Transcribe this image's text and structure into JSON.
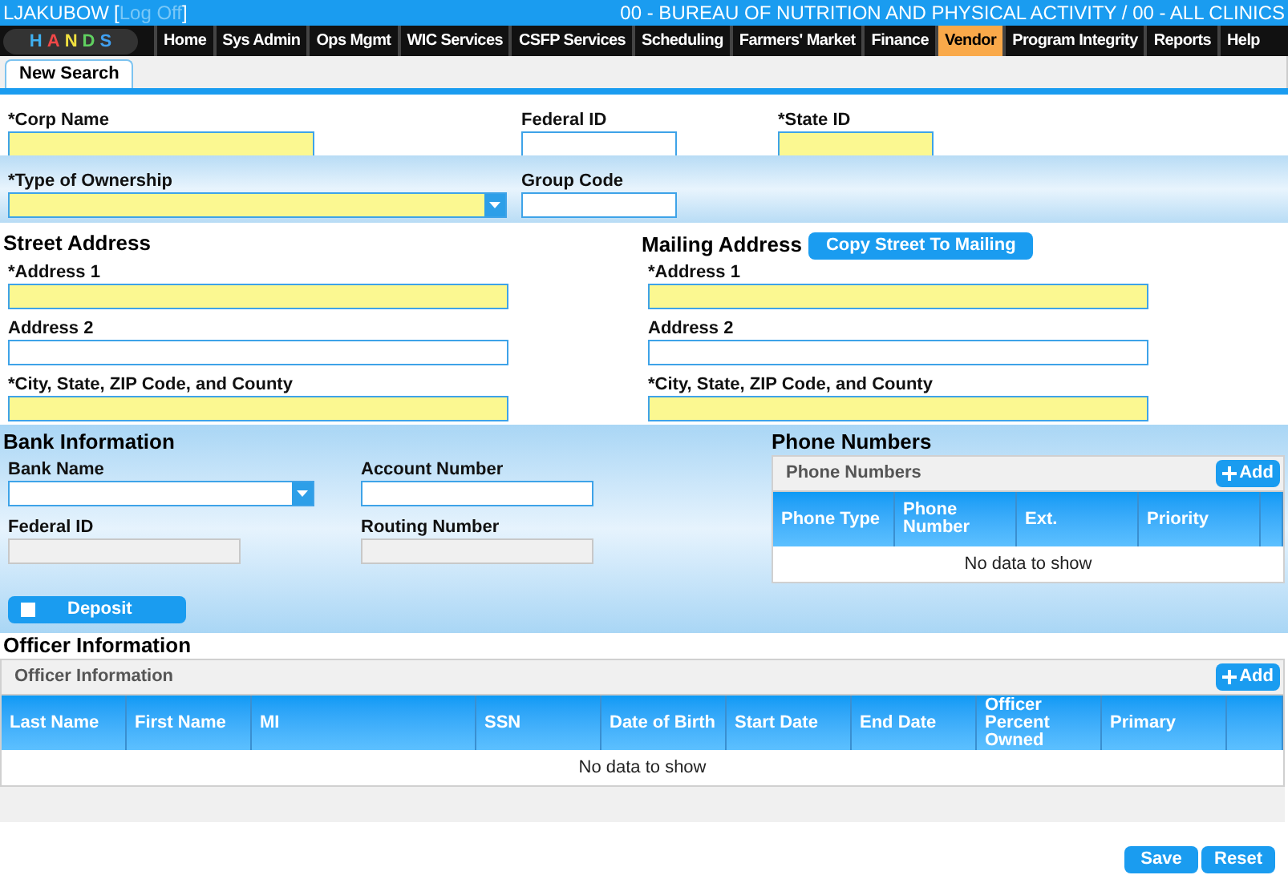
{
  "header": {
    "user": "LJAKUBOW",
    "open_bracket": "[",
    "logoff": "Log Off",
    "close_bracket": "]",
    "agency": "00 - BUREAU OF NUTRITION AND PHYSICAL ACTIVITY / 00 - ALL CLINICS"
  },
  "logo": {
    "letters": [
      {
        "text": "H",
        "color": "#3fb0f0"
      },
      {
        "text": "A",
        "color": "#f04848"
      },
      {
        "text": "N",
        "color": "#f0e040"
      },
      {
        "text": "D",
        "color": "#60d060"
      },
      {
        "text": "S",
        "color": "#40a0f0"
      }
    ]
  },
  "nav": [
    {
      "label": "Home",
      "selected": false
    },
    {
      "label": "Sys Admin",
      "selected": false
    },
    {
      "label": "Ops Mgmt",
      "selected": false
    },
    {
      "label": "WIC Services",
      "selected": false
    },
    {
      "label": "CSFP Services",
      "selected": false
    },
    {
      "label": "Scheduling",
      "selected": false
    },
    {
      "label": "Farmers' Market",
      "selected": false
    },
    {
      "label": "Finance",
      "selected": false
    },
    {
      "label": "Vendor",
      "selected": true
    },
    {
      "label": "Program Integrity",
      "selected": false
    },
    {
      "label": "Reports",
      "selected": false
    },
    {
      "label": "Help",
      "selected": false
    }
  ],
  "tabs": [
    {
      "label": "New Search",
      "selected": true
    }
  ],
  "corp_row": [
    {
      "label": "*Corp Name",
      "kind": "text",
      "required": true,
      "disabled": false
    },
    {
      "label": "Federal ID",
      "kind": "text",
      "required": false,
      "disabled": false
    },
    {
      "label": "*State ID",
      "kind": "text",
      "required": true,
      "disabled": false
    }
  ],
  "ownership_row": [
    {
      "label": "*Type of Ownership",
      "kind": "select",
      "required": true,
      "disabled": false
    },
    {
      "label": "Group Code",
      "kind": "text",
      "required": false,
      "disabled": false
    }
  ],
  "street_address": {
    "title": "Street Address",
    "fields": [
      {
        "label": "*Address 1",
        "kind": "text",
        "required": true,
        "disabled": false
      },
      {
        "label": "Address 2",
        "kind": "text",
        "required": false,
        "disabled": false
      },
      {
        "label": "*City, State, ZIP Code, and County",
        "kind": "text",
        "required": true,
        "disabled": false
      }
    ]
  },
  "mailing_address": {
    "title": "Mailing Address",
    "copy_button": "Copy Street To Mailing",
    "fields": [
      {
        "label": "*Address 1",
        "kind": "text",
        "required": true,
        "disabled": false
      },
      {
        "label": "Address 2",
        "kind": "text",
        "required": false,
        "disabled": false
      },
      {
        "label": "*City, State, ZIP Code, and County",
        "kind": "text",
        "required": true,
        "disabled": false
      }
    ]
  },
  "bank": {
    "title": "Bank Information",
    "fields": [
      {
        "label": "Bank Name",
        "kind": "select",
        "required": false,
        "disabled": false
      },
      {
        "label": "Account Number",
        "kind": "text",
        "required": false,
        "disabled": false
      },
      {
        "label": "Federal ID",
        "kind": "text",
        "required": false,
        "disabled": true
      },
      {
        "label": "Routing Number",
        "kind": "text",
        "required": false,
        "disabled": true
      }
    ],
    "deposit": {
      "label": "Deposit",
      "checked": false
    }
  },
  "phone_numbers": {
    "title": "Phone Numbers",
    "grid_title": "Phone Numbers",
    "add": "Add",
    "columns": [
      "Phone Type",
      "Phone Number",
      "Ext.",
      "Priority"
    ],
    "empty": "No data to show"
  },
  "officer_information": {
    "title": "Officer Information",
    "grid_title": "Officer Information",
    "add": "Add",
    "columns": [
      "Last Name",
      "First Name",
      "MI",
      "SSN",
      "Date of Birth",
      "Start Date",
      "End Date",
      "Officer Percent Owned",
      "Primary"
    ],
    "empty": "No data to show"
  },
  "buttons": [
    "Save",
    "Reset"
  ]
}
